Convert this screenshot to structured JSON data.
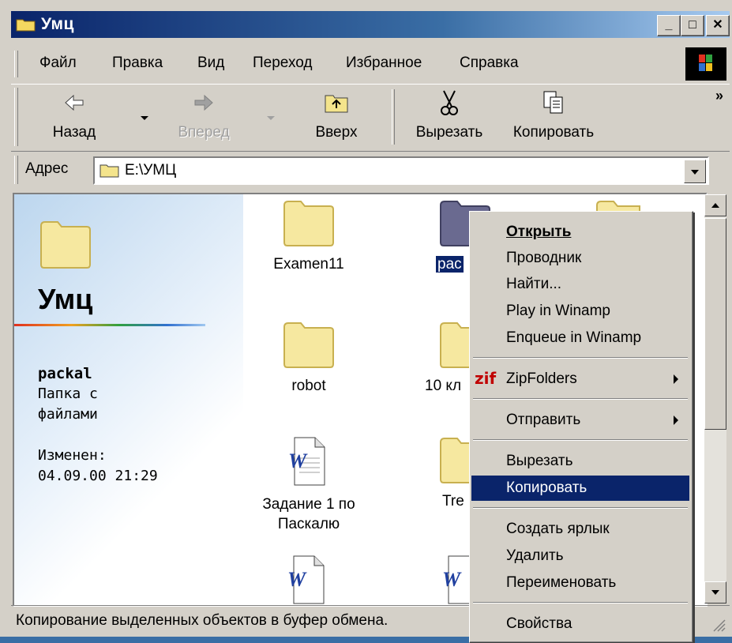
{
  "window": {
    "title": "Умц",
    "controls": [
      "_",
      "□",
      "✕"
    ]
  },
  "menubar": {
    "items": [
      "Файл",
      "Правка",
      "Вид",
      "Переход",
      "Избранное",
      "Справка"
    ]
  },
  "toolbar": {
    "back": "Назад",
    "forward": "Вперед",
    "up": "Вверх",
    "cut": "Вырезать",
    "copy": "Копировать",
    "more": "»"
  },
  "address": {
    "label": "Адрес",
    "value": "E:\\УМЦ"
  },
  "webpanel": {
    "folder_title": "Умц",
    "selected_name": "packal",
    "desc_line1": "Папка с",
    "desc_line2": "файлами",
    "modified_label": "Изменен:",
    "modified_value": "04.09.00 21:29"
  },
  "files": [
    {
      "name": "Examen11",
      "type": "folder"
    },
    {
      "name": "pac",
      "type": "folder",
      "selected": true
    },
    {
      "name": "robot",
      "type": "folder"
    },
    {
      "name": "10 кл",
      "type": "folder"
    },
    {
      "name": "Задание 1 по Паскалю",
      "line1": "Задание 1 по",
      "line2": "Паскалю",
      "type": "word-doc"
    },
    {
      "name": "Tre",
      "type": "folder"
    }
  ],
  "context_menu": {
    "items": [
      "Открыть",
      "Проводник",
      "Найти...",
      "Play in Winamp",
      "Enqueue in Winamp",
      "ZipFolders",
      "Отправить",
      "Вырезать",
      "Копировать",
      "Создать ярлык",
      "Удалить",
      "Переименовать",
      "Свойства"
    ],
    "zip_prefix": "zif",
    "highlighted": "Копировать"
  },
  "status": {
    "text": "Копирование выделенных объектов в буфер обмена."
  },
  "colors": {
    "titlebar": "#0a246a",
    "highlight": "#0a246a",
    "face": "#d4d0c8",
    "folder": "#f4e48c"
  }
}
